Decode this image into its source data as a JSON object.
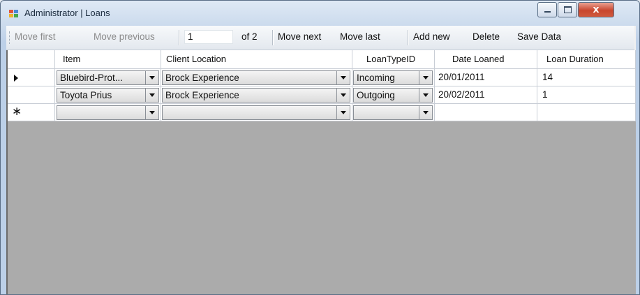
{
  "window": {
    "title": "Administrator | Loans",
    "close_glyph": "x"
  },
  "toolbar": {
    "move_first": "Move first",
    "move_previous": "Move previous",
    "position": "1",
    "count": "of 2",
    "move_next": "Move next",
    "move_last": "Move last",
    "add_new": "Add new",
    "delete": "Delete",
    "save_data": "Save Data"
  },
  "grid": {
    "columns": [
      "Item",
      "Client Location",
      "LoanTypeID",
      "Date Loaned",
      "Loan Duration"
    ],
    "rows": [
      {
        "item": "Bluebird-Prot...",
        "client_location": "Brock Experience",
        "loan_type": "Incoming",
        "date_loaned": "20/01/2011",
        "loan_duration": "14"
      },
      {
        "item": "Toyota Prius",
        "client_location": "Brock Experience",
        "loan_type": "Outgoing",
        "date_loaned": "20/02/2011",
        "loan_duration": "1"
      }
    ],
    "new_row_marker": "∗"
  },
  "colors": {
    "grid_background": "#ababab",
    "close_button": "#c8462e"
  },
  "icons": [
    "app-icon",
    "minimize-icon",
    "maximize-icon",
    "close-icon",
    "current-row-indicator-icon",
    "new-row-star-icon",
    "dropdown-arrow-icon"
  ]
}
